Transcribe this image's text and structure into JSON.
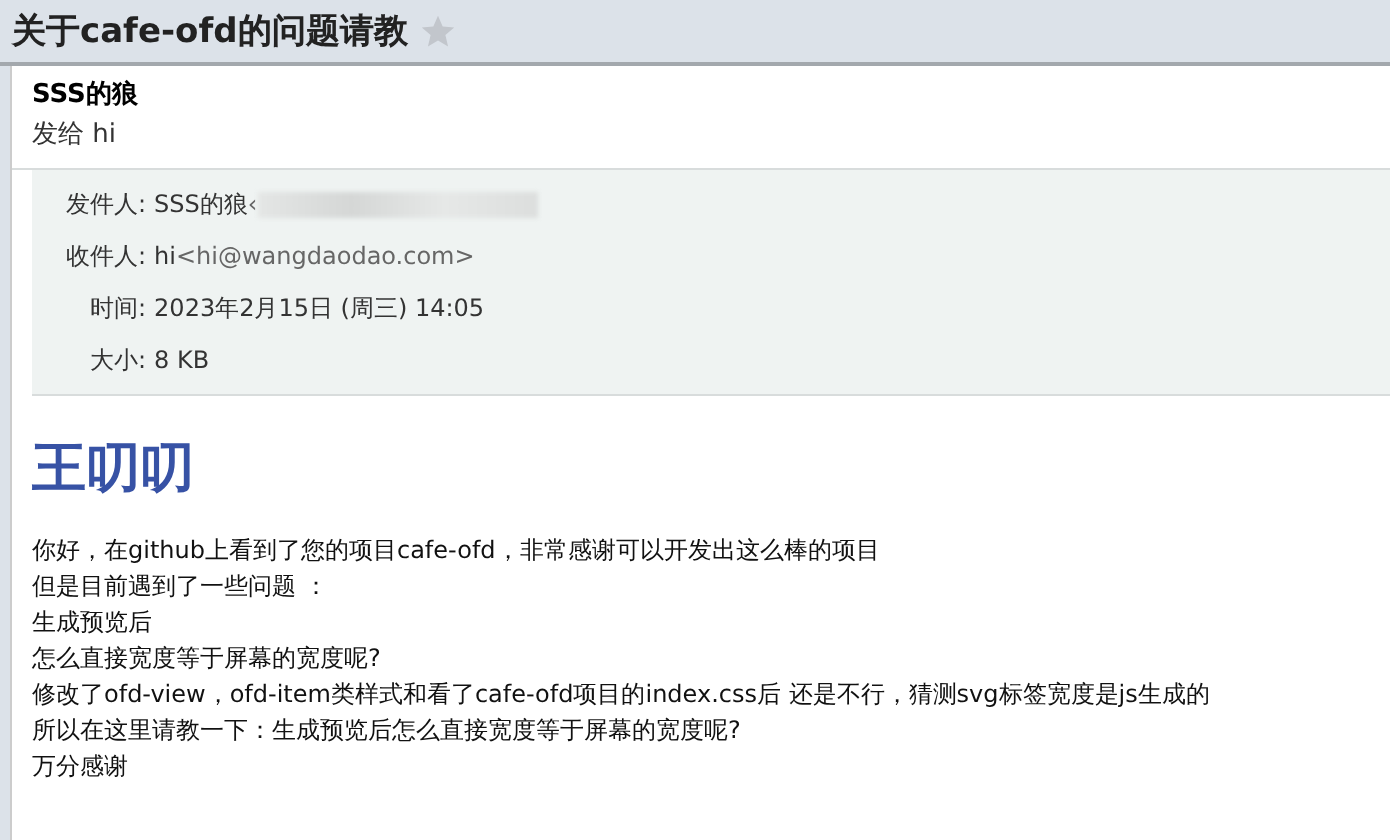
{
  "subject": "关于cafe-ofd的问题请教",
  "starred": false,
  "sender": {
    "name": "SSS的狼",
    "to": "发给 hi"
  },
  "meta": [
    {
      "label": "发件人:",
      "value": "SSS的狼",
      "address": "‹"
    },
    {
      "label": "收件人:",
      "value": "hi",
      "address": "<hi@wangdaodao.com>"
    },
    {
      "label": "时间:",
      "value": "2023年2月15日 (周三) 14:05"
    },
    {
      "label": "大小:",
      "value": "8 KB"
    }
  ],
  "sender_address_redacted": true,
  "heading": "王叨叨",
  "lines": [
    "你好，在github上看到了您的项目cafe-ofd，非常感谢可以开发出这么棒的项目",
    "但是目前遇到了一些问题 ：",
    "生成预览后",
    "怎么直接宽度等于屏幕的宽度呢?",
    "修改了ofd-view，ofd-item类样式和看了cafe-ofd项目的index.css后 还是不行，猜测svg标签宽度是js生成的",
    "所以在这里请教一下：生成预览后怎么直接宽度等于屏幕的宽度呢?",
    "万分感谢"
  ]
}
